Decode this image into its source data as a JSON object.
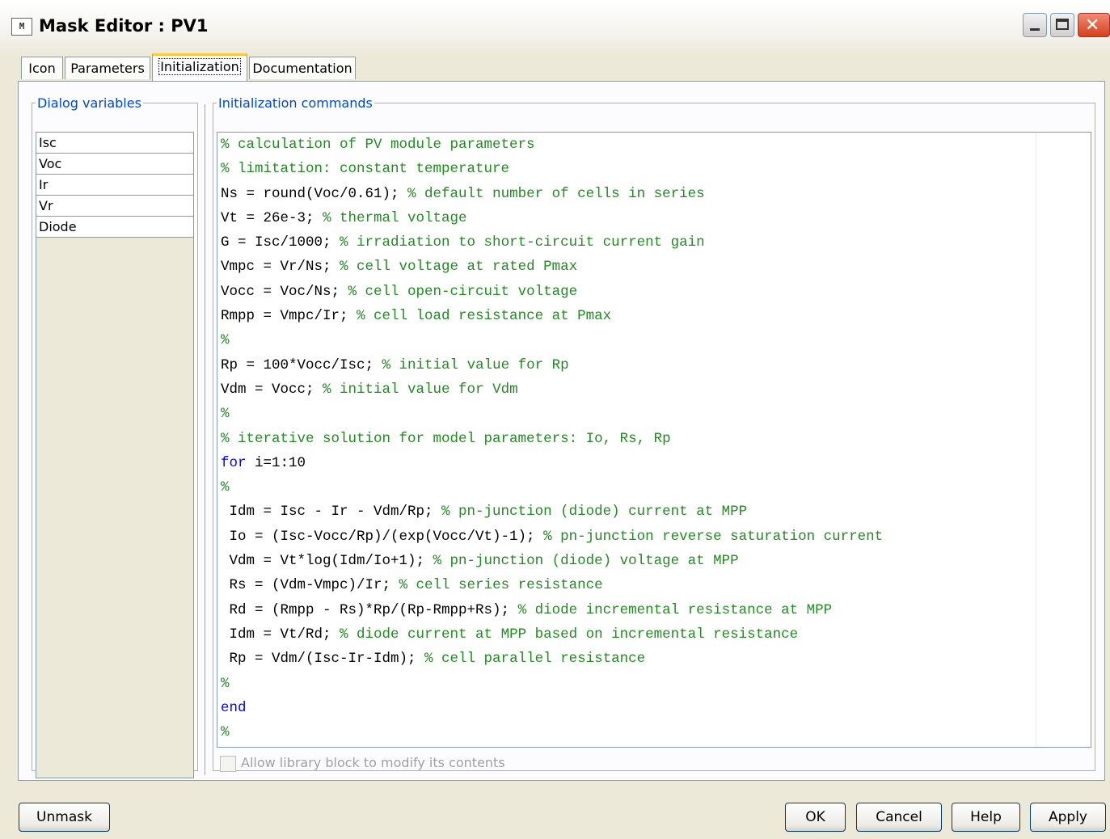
{
  "window": {
    "title": "Mask Editor : PV1",
    "icon_name": "simulink-mask-icon"
  },
  "tabs": [
    {
      "label": "Icon",
      "active": false
    },
    {
      "label": "Parameters",
      "active": false
    },
    {
      "label": "Initialization",
      "active": true
    },
    {
      "label": "Documentation",
      "active": false
    }
  ],
  "dialog_variables": {
    "legend": "Dialog variables",
    "items": [
      "Isc",
      "Voc",
      "Ir",
      "Vr",
      "Diode"
    ]
  },
  "init_commands": {
    "legend": "Initialization commands",
    "lines": [
      "% calculation of PV module parameters",
      "% limitation: constant temperature",
      "Ns = round(Voc/0.61); % default number of cells in series",
      "Vt = 26e-3; % thermal voltage",
      "G = Isc/1000; % irradiation to short-circuit current gain",
      "Vmpc = Vr/Ns; % cell voltage at rated Pmax",
      "Vocc = Voc/Ns; % cell open-circuit voltage",
      "Rmpp = Vmpc/Ir; % cell load resistance at Pmax",
      "%",
      "Rp = 100*Vocc/Isc; % initial value for Rp",
      "Vdm = Vocc; % initial value for Vdm",
      "%",
      "% iterative solution for model parameters: Io, Rs, Rp",
      "for i=1:10",
      "%",
      " Idm = Isc - Ir - Vdm/Rp; % pn-junction (diode) current at MPP",
      " Io = (Isc-Vocc/Rp)/(exp(Vocc/Vt)-1); % pn-junction reverse saturation current",
      " Vdm = Vt*log(Idm/Io+1); % pn-junction (diode) voltage at MPP",
      " Rs = (Vdm-Vmpc)/Ir; % cell series resistance",
      " Rd = (Rmpp - Rs)*Rp/(Rp-Rmpp+Rs); % diode incremental resistance at MPP",
      " Idm = Vt/Rd; % diode current at MPP based on incremental resistance",
      " Rp = Vdm/(Isc-Ir-Idm); % cell parallel resistance",
      "%",
      "end",
      "%"
    ]
  },
  "allow_library": {
    "label": "Allow library block to modify its contents",
    "checked": false,
    "enabled": false
  },
  "buttons": {
    "unmask": "Unmask",
    "ok": "OK",
    "cancel": "Cancel",
    "help": "Help",
    "apply": "Apply"
  },
  "colors": {
    "comment": "#228b22",
    "keyword": "#0000ff",
    "legend": "#0046d5"
  }
}
